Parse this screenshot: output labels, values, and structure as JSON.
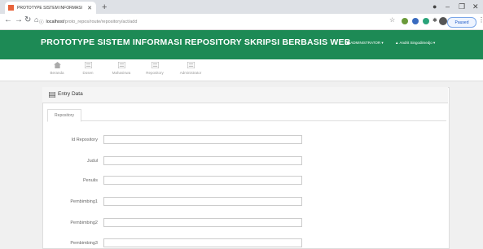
{
  "browser": {
    "tab_title": "PROTOTYPE SISTEM INFORMASI",
    "url_host": "localhost",
    "url_path": "/proto_repos/route/repository/act/add",
    "paused_label": "Paused"
  },
  "header": {
    "title": "PROTOTYPE SISTEM INFORMASI REPOSITORY SKRIPSI BERBASIS WEB",
    "admin_label": "ADMINISTRATOR",
    "user_label": "Andrit Singodimedjo"
  },
  "nav": {
    "items": [
      {
        "label": "Beranda"
      },
      {
        "label": "Dosen"
      },
      {
        "label": "Mahasiswa"
      },
      {
        "label": "Repository"
      },
      {
        "label": "Administrator"
      }
    ]
  },
  "panel": {
    "title": "Entry Data",
    "tab_label": "Repository"
  },
  "form": {
    "fields": [
      {
        "label": "Id Repository",
        "value": ""
      },
      {
        "label": "Judul",
        "value": ""
      },
      {
        "label": "Penulis",
        "value": ""
      },
      {
        "label": "Pembimbing1",
        "value": ""
      },
      {
        "label": "Pembimbing2",
        "value": ""
      },
      {
        "label": "Pembimbing3",
        "value": ""
      }
    ]
  },
  "colors": {
    "header_green": "#1d8a55",
    "tab_favicon": "#e8643c"
  }
}
